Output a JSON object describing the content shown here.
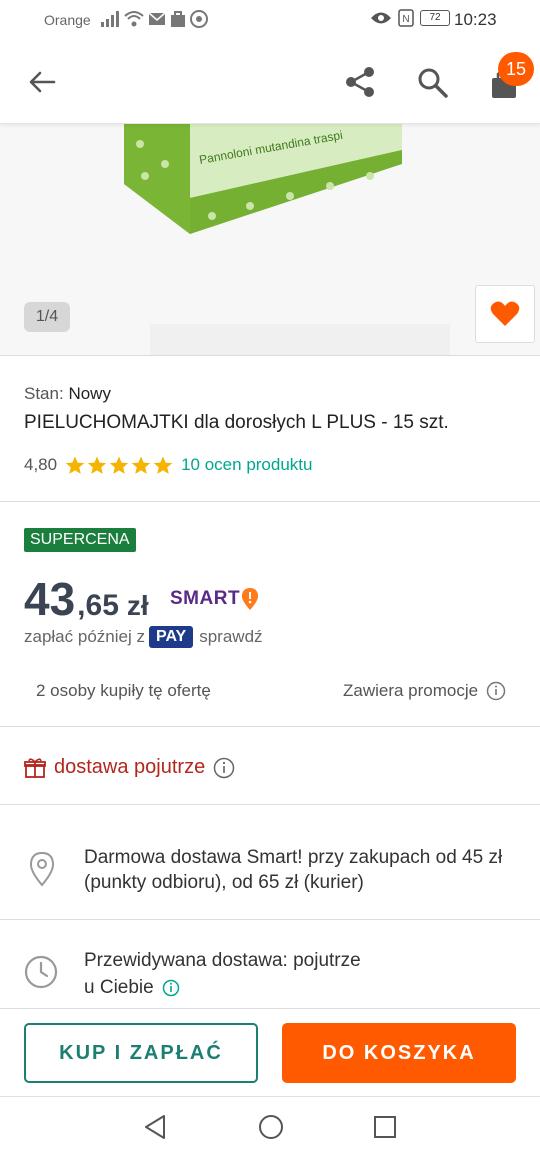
{
  "status_bar": {
    "carrier": "Orange",
    "battery": "72",
    "time": "10:23"
  },
  "app_bar": {
    "cart_count": "15",
    "icons": [
      "back-arrow-icon",
      "share-icon",
      "search-icon",
      "cart-icon"
    ]
  },
  "gallery": {
    "counter": "1/4",
    "product_text": "Pannoloni mutandina traspi"
  },
  "product": {
    "condition_label": "Stan:",
    "condition_value": "Nowy",
    "title": "PIELUCHOMAJTKI dla dorosłych L PLUS - 15 szt.",
    "rating": "4,80",
    "stars": 5,
    "rating_link": "10 ocen produktu"
  },
  "pricing": {
    "badge": "SUPERCENA",
    "price_int": "43",
    "price_frac": ",65",
    "currency": "zł",
    "smart_label": "SMART",
    "pay_prefix": "zapłać później z",
    "pay_logo": "PAY",
    "pay_suffix": "sprawdź",
    "buyers": "2 osoby kupiły tę ofertę",
    "promo": "Zawiera promocje"
  },
  "delivery": {
    "headline": "dostawa pojutrze",
    "free_shipping": "Darmowa dostawa Smart! przy zakupach od 45 zł (punkty odbioru), od 65 zł (kurier)",
    "eta_line1": "Przewidywana dostawa: pojutrze",
    "eta_line2": "u Ciebie"
  },
  "actions": {
    "buy_now": "KUP I ZAPŁAĆ",
    "add_to_cart": "DO KOSZYKA"
  },
  "colors": {
    "accent": "#ff5a00",
    "teal": "#00a790",
    "badge_green": "#1a7f3c",
    "delivery_red": "#b3261e",
    "smart_purple": "#5b2a86"
  }
}
